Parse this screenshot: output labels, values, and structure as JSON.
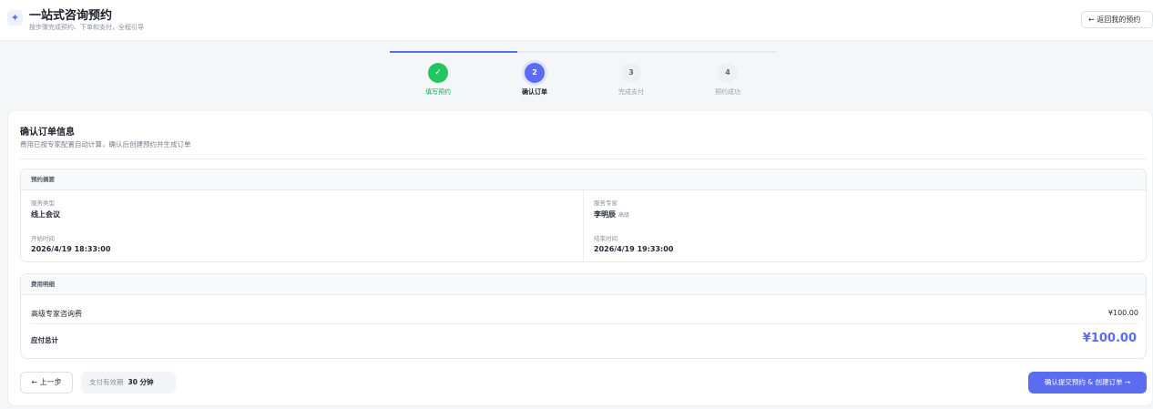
{
  "header": {
    "logo_glyph": "✦",
    "title": "一站式咨询预约",
    "subtitle": "按步骤完成预约、下单和支付，全程引导",
    "back_label": "← 返回我的预约"
  },
  "stepper": {
    "progress_fraction": 0.33,
    "steps": [
      {
        "number": "✓",
        "label": "填写预约",
        "state": "done"
      },
      {
        "number": "2",
        "label": "确认订单",
        "state": "active"
      },
      {
        "number": "3",
        "label": "完成支付",
        "state": "pending"
      },
      {
        "number": "4",
        "label": "预约成功",
        "state": "pending"
      }
    ]
  },
  "card": {
    "title": "确认订单信息",
    "description": "费用已按专家配置自动计算，确认后创建预约并生成订单"
  },
  "summary": {
    "heading": "预约摘要",
    "service_type_label": "服务类型",
    "service_type_value": "线上会议",
    "expert_label": "服务专家",
    "expert_name": "李明辰",
    "expert_level": "高级",
    "start_label": "开始时间",
    "start_value": "2026/4/19 18:33:00",
    "end_label": "结束时间",
    "end_value": "2026/4/19 19:33:00"
  },
  "fees": {
    "heading": "费用明细",
    "item_label": "高级专家咨询费",
    "item_amount": "¥100.00",
    "total_label": "应付总计",
    "total_amount": "¥100.00"
  },
  "footer": {
    "prev_label": "← 上一步",
    "timer_label": "支付有效期",
    "timer_value": "30 分钟",
    "submit_label": "确认提交预约 & 创建订单 →"
  },
  "colors": {
    "accent": "#5b6cf0",
    "success": "#22c55e"
  }
}
